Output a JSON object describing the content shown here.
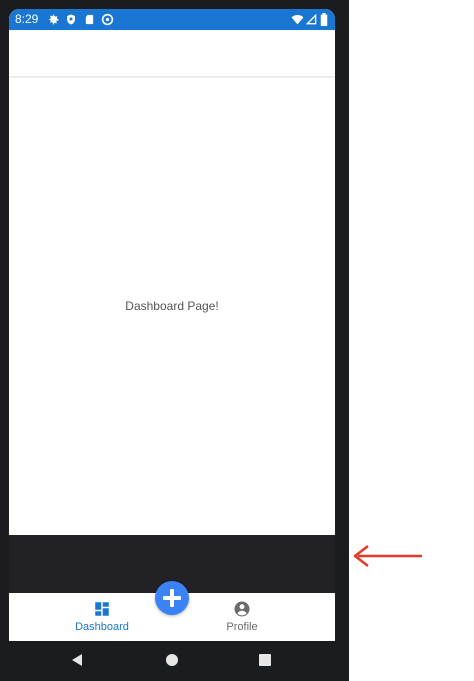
{
  "status_bar": {
    "time": "8:29",
    "left_icons": [
      "gear-icon",
      "shield-icon",
      "sd-card-icon",
      "at-sign-icon"
    ],
    "right_icons": [
      "wifi-icon",
      "signal-icon",
      "battery-icon"
    ]
  },
  "content": {
    "message": "Dashboard Page!"
  },
  "tab_bar": {
    "tabs": [
      {
        "label": "Dashboard",
        "icon": "dashboard-icon",
        "active": true
      },
      {
        "label": "Profile",
        "icon": "profile-icon",
        "active": false
      }
    ],
    "fab_icon": "plus-icon"
  },
  "colors": {
    "primary": "#1976d2",
    "accent": "#3b82f6",
    "inactive": "#6b6b6b",
    "dark_band": "#222226",
    "arrow": "#e53a2a"
  },
  "nav_bar": {
    "buttons": [
      "back-icon",
      "home-icon",
      "recents-icon"
    ]
  }
}
